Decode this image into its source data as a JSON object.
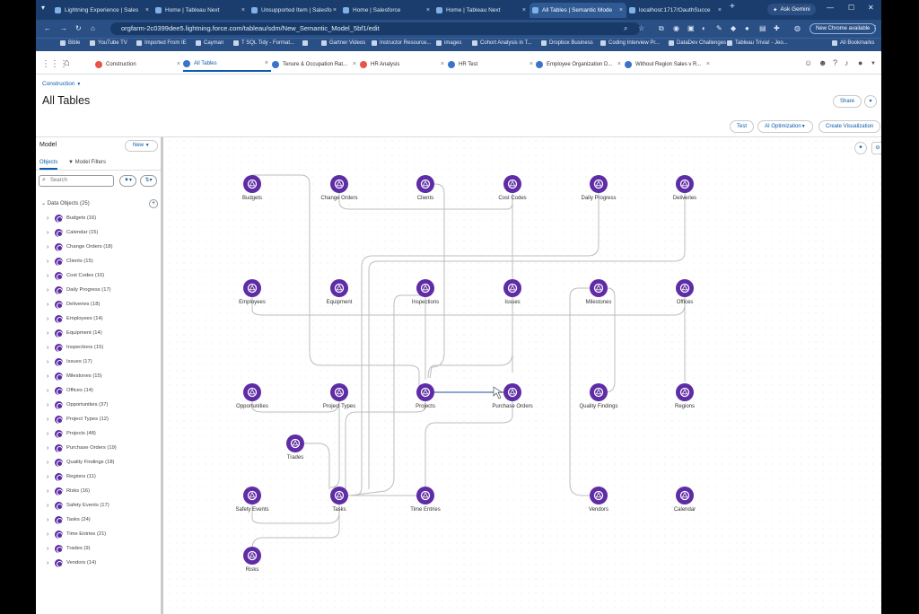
{
  "browser": {
    "tabs": [
      {
        "label": "Lightning Experience | Sales"
      },
      {
        "label": "Home | Tableau Next"
      },
      {
        "label": "Unsupported Item | Salesfo"
      },
      {
        "label": "Home | Salesforce"
      },
      {
        "label": "Home | Tableau Next"
      },
      {
        "label": "All Tables | Semantic Mode"
      },
      {
        "label": "localhost:1717/OauthSucce"
      }
    ],
    "new_tab": "+",
    "ask_gemini": "Ask Gemini",
    "url": "orgfarm-2c0399dee5.lightning.force.com/tableau/sdm/New_Semantic_Model_5bf1/edit",
    "new_chrome": "New Chrome available",
    "bookmarks": [
      "Bible",
      "YouTube TV",
      "Imported From IE",
      "Cayman",
      "T SQL Tidy - Format...",
      "",
      "Gartner Videos",
      "Instructor Resource...",
      "images",
      "Cohort Analysis in T...",
      "Dropbox Business",
      "Coding Interview Pr...",
      "DataDev Challenges",
      "Tableau Trivia! - Jeo..."
    ],
    "all_bookmarks": "All Bookmarks"
  },
  "sf_tabs": [
    {
      "label": "Construction",
      "color": "#e8534a"
    },
    {
      "label": "All Tables",
      "color": "#3a73c9"
    },
    {
      "label": "Tenure & Occupation Rat...",
      "color": "#3a73c9"
    },
    {
      "label": "HR Analysis",
      "color": "#e8534a"
    },
    {
      "label": "HR Test",
      "color": "#3a73c9"
    },
    {
      "label": "Employee Organization D...",
      "color": "#3a73c9"
    },
    {
      "label": "Without Region Sales v R...",
      "color": "#3a73c9"
    }
  ],
  "page": {
    "breadcrumb": "Construction",
    "title": "All Tables",
    "share": "Share",
    "test": "Test",
    "ai_optimization": "AI Optimization",
    "create_visualization": "Create Visualization"
  },
  "left_panel": {
    "title": "Model",
    "new_button": "New",
    "tab_objects": "Objects",
    "tab_filters": "Model Filters",
    "search_placeholder": "Search",
    "group_label": "Data Objects (25)",
    "objects": [
      "Budgets (16)",
      "Calendar (15)",
      "Change Orders (18)",
      "Clients (15)",
      "Cost Codes (10)",
      "Daily Progress (17)",
      "Deliveries (18)",
      "Employees (14)",
      "Equipment (14)",
      "Inspections (15)",
      "Issues (17)",
      "Milestones (15)",
      "Offices (14)",
      "Opportunities (37)",
      "Project Types (12)",
      "Projects (48)",
      "Purchase Orders (19)",
      "Quality Findings (18)",
      "Regions (11)",
      "Risks (16)",
      "Safety Events (17)",
      "Tasks (24)",
      "Time Entries (21)",
      "Trades (9)",
      "Vendors (14)"
    ]
  },
  "graph": {
    "nodes": [
      {
        "id": "budgets",
        "label": "Budgets"
      },
      {
        "id": "change_orders",
        "label": "Change Orders"
      },
      {
        "id": "clients",
        "label": "Clients"
      },
      {
        "id": "cost_codes",
        "label": "Cost Codes"
      },
      {
        "id": "daily_progress",
        "label": "Daily Progress"
      },
      {
        "id": "deliveries",
        "label": "Deliveries"
      },
      {
        "id": "employees",
        "label": "Employees"
      },
      {
        "id": "equipment",
        "label": "Equipment"
      },
      {
        "id": "inspections",
        "label": "Inspections"
      },
      {
        "id": "issues",
        "label": "Issues"
      },
      {
        "id": "milestones",
        "label": "Milestones"
      },
      {
        "id": "offices",
        "label": "Offices"
      },
      {
        "id": "opportunities",
        "label": "Opportunities"
      },
      {
        "id": "project_types",
        "label": "Project Types"
      },
      {
        "id": "projects",
        "label": "Projects"
      },
      {
        "id": "purchase_orders",
        "label": "Purchase Orders"
      },
      {
        "id": "quality_findings",
        "label": "Quality Findings"
      },
      {
        "id": "regions",
        "label": "Regions"
      },
      {
        "id": "trades",
        "label": "Trades"
      },
      {
        "id": "safety_events",
        "label": "Safety Events"
      },
      {
        "id": "tasks",
        "label": "Tasks"
      },
      {
        "id": "time_entries",
        "label": "Time Entries"
      },
      {
        "id": "vendors",
        "label": "Vendors"
      },
      {
        "id": "calendar",
        "label": "Calendar"
      },
      {
        "id": "risks",
        "label": "Risks"
      }
    ],
    "node_color": "#5e2ca5"
  }
}
